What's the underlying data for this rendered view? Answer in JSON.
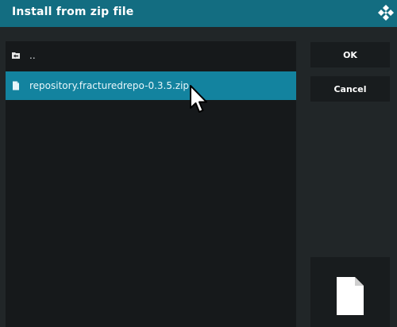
{
  "dialog": {
    "title": "Install from zip file"
  },
  "file_list": {
    "items": [
      {
        "label": "..",
        "icon": "folder-back-icon",
        "selected": false
      },
      {
        "label": "repository.fracturedrepo-0.3.5.zip",
        "icon": "file-icon",
        "selected": true
      }
    ]
  },
  "buttons": {
    "ok_label": "OK",
    "cancel_label": "Cancel"
  },
  "preview": {
    "icon": "file-large-icon"
  },
  "colors": {
    "title_bar": "#136d81",
    "selection": "#13839f",
    "background": "#1f2426",
    "panel": "#16191b",
    "button": "#181c1e"
  }
}
